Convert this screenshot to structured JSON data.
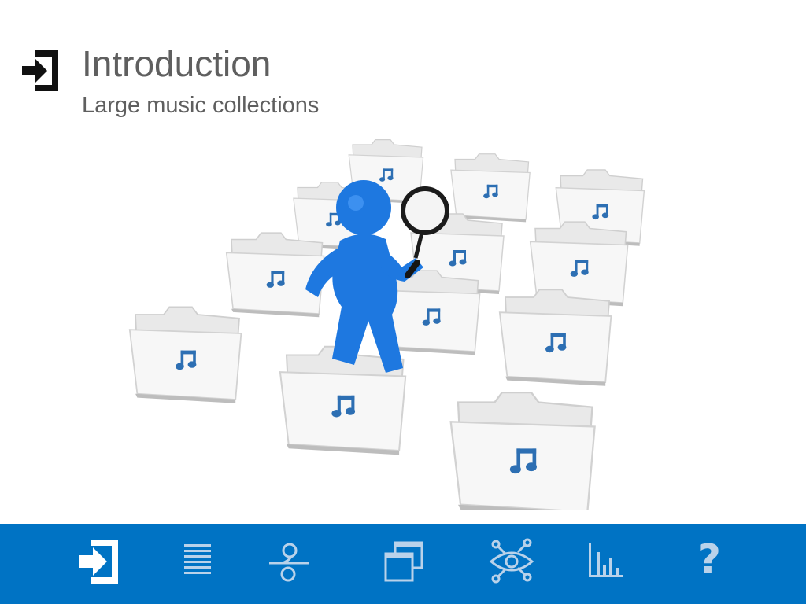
{
  "slide": {
    "title": "Introduction",
    "subtitle": "Large music collections",
    "header_icon": "sign-in-icon",
    "illustration": "person-searching-music-folders"
  },
  "nav": {
    "items": [
      {
        "icon": "sign-in-icon",
        "active": true
      },
      {
        "icon": "list-lines-icon",
        "active": false
      },
      {
        "icon": "split-circles-icon",
        "active": false
      },
      {
        "icon": "stacked-windows-icon",
        "active": false
      },
      {
        "icon": "eye-network-icon",
        "active": false
      },
      {
        "icon": "bar-chart-icon",
        "active": false
      },
      {
        "icon": "help-icon",
        "active": false,
        "label": "?"
      }
    ]
  },
  "colors": {
    "nav_background": "#0073c4",
    "nav_icon_active": "#ffffff",
    "nav_icon_inactive": "#b9d2ea",
    "title_text": "#5f5f5f",
    "figure_blue": "#1e78e0"
  }
}
